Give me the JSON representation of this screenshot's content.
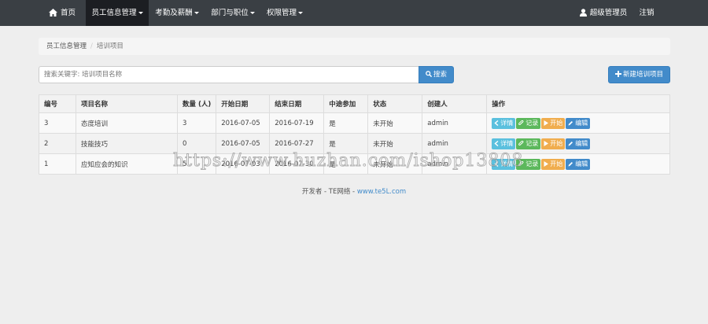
{
  "nav": {
    "home": "首页",
    "menus": [
      "员工信息管理",
      "考勤及薪酬",
      "部门与职位",
      "权限管理"
    ],
    "user": "超级管理员",
    "logout": "注销"
  },
  "breadcrumb": {
    "parent": "员工信息管理",
    "separator": "/",
    "current": "培训项目"
  },
  "search": {
    "placeholder": "搜索关键字: 培训项目名称",
    "button": "搜索"
  },
  "new_button": "新建培训项目",
  "table": {
    "headers": [
      "编号",
      "项目名称",
      "数量 (人)",
      "开始日期",
      "结束日期",
      "中途参加",
      "状态",
      "创建人",
      "操作"
    ],
    "rows": [
      {
        "id": "3",
        "name": "态度培训",
        "count": "3",
        "start": "2016-07-05",
        "end": "2016-07-19",
        "midway": "是",
        "status": "未开始",
        "creator": "admin"
      },
      {
        "id": "2",
        "name": "技能技巧",
        "count": "0",
        "start": "2016-07-05",
        "end": "2016-07-27",
        "midway": "是",
        "status": "未开始",
        "creator": "admin"
      },
      {
        "id": "1",
        "name": "应知应会的知识",
        "count": "5",
        "start": "2016-07-03",
        "end": "2016-07-30",
        "midway": "是",
        "status": "未开始",
        "creator": "admin"
      }
    ],
    "actions": {
      "detail": "详情",
      "record": "记录",
      "start": "开始",
      "edit": "编辑"
    }
  },
  "footer": {
    "text": "开发者 - TE网络 - ",
    "link": "www.te5L.com"
  },
  "watermark": "https://www.huzhan.com/ishop13808",
  "colors": {
    "navbar": "#3a3f44",
    "primary": "#428bca",
    "info": "#5bc0de",
    "success": "#5cb85c",
    "warning": "#f0ad4e"
  }
}
